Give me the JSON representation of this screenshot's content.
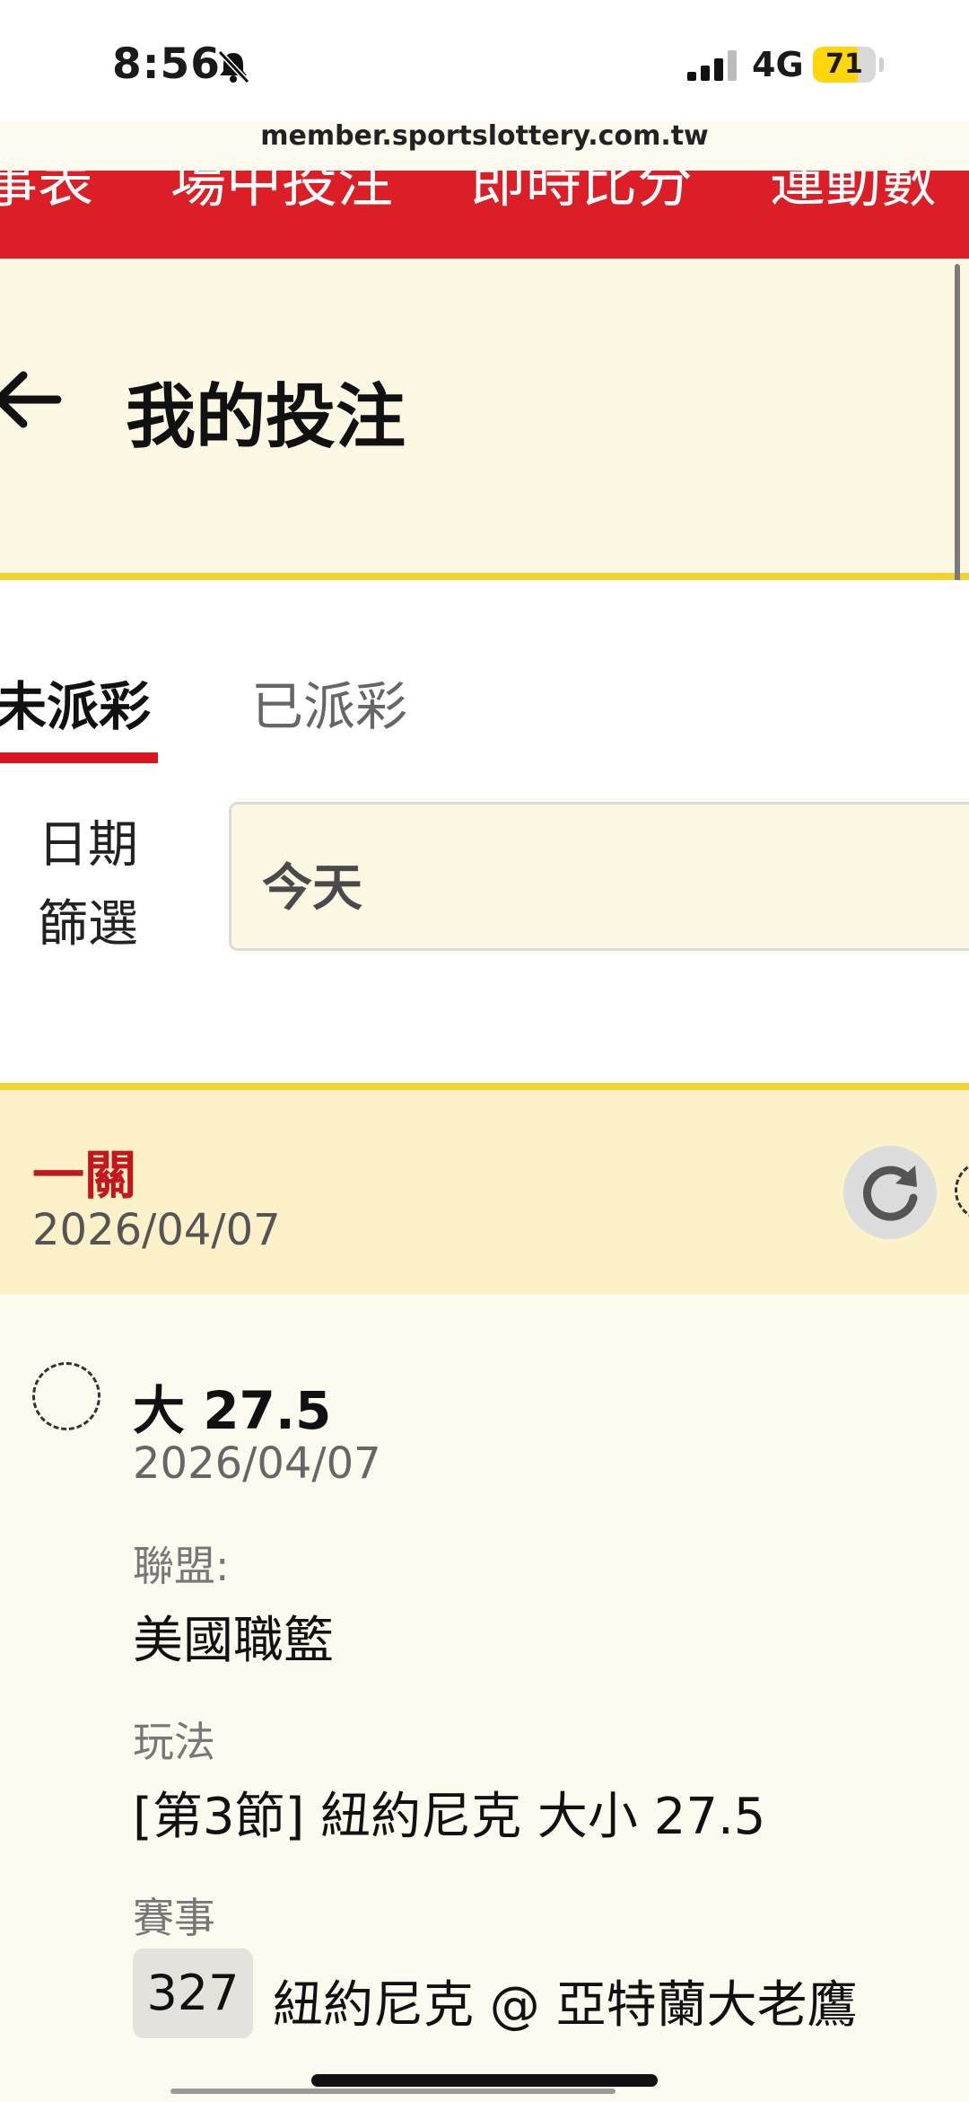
{
  "status_bar": {
    "time": "8:56",
    "network": "4G",
    "battery": "71",
    "silent_icon": "bell-slash-icon",
    "signal_icon": "cellular-signal-icon"
  },
  "browser": {
    "url": "member.sportslottery.com.tw"
  },
  "top_nav": {
    "items": [
      "事表",
      "場中投注",
      "即時比分",
      "運動數"
    ]
  },
  "header": {
    "title": "我的投注",
    "back_icon": "back-arrow-icon"
  },
  "tabs": [
    {
      "label": "未派彩",
      "active": true
    },
    {
      "label": "已派彩",
      "active": false
    }
  ],
  "date_filter": {
    "label": "日期篩選",
    "value": "今天"
  },
  "bet_card": {
    "type": "一關",
    "date": "2026/04/07",
    "refresh_icon": "refresh-icon",
    "selection": {
      "name": "大 27.5",
      "date": "2026/04/07",
      "league_label": "聯盟:",
      "league": "美國職籃",
      "market_label": "玩法",
      "market": "[第3節] 紐約尼克 大小 27.5",
      "event_label": "賽事",
      "event_number": "327",
      "event_name": "紐約尼克 @ 亞特蘭大老鷹"
    }
  },
  "colors": {
    "brand_red": "#dc1f26",
    "accent_yellow": "#f5d234",
    "header_bg": "#fdf8e4",
    "card_header_bg": "#fcf1c8"
  }
}
